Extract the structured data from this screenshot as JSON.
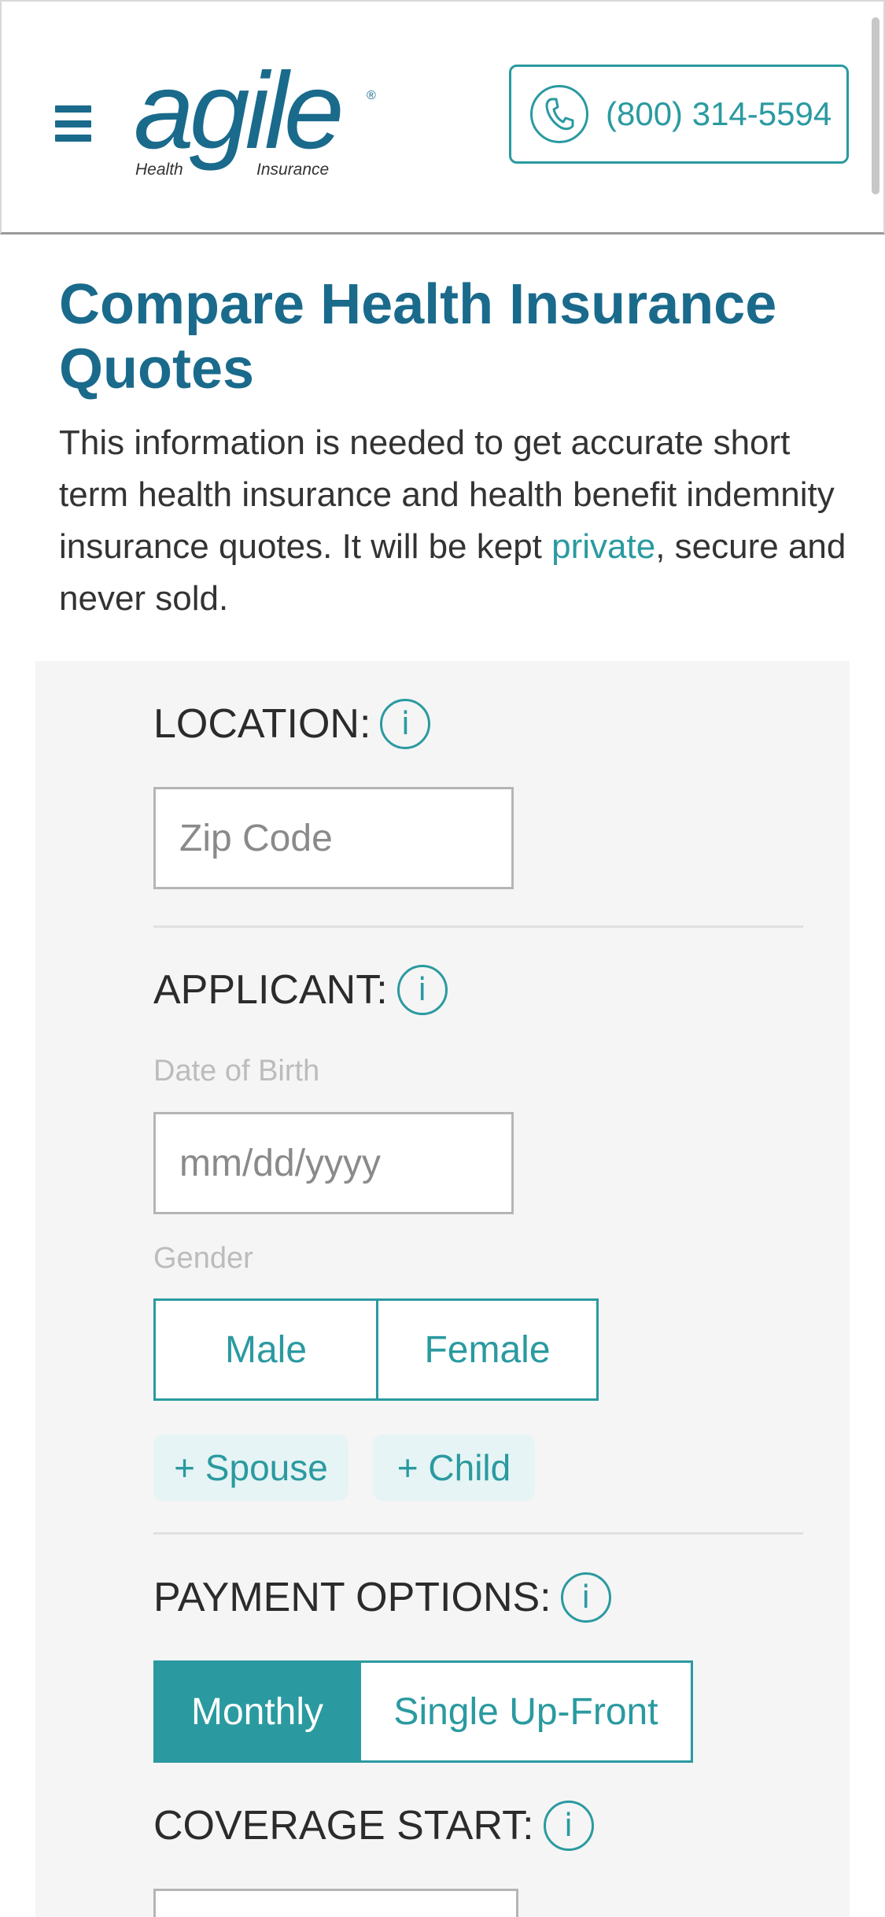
{
  "header": {
    "logo": {
      "wordmark": "agile",
      "sub_left": "Health",
      "sub_right": "Insurance",
      "registered": "®"
    },
    "phone": "(800) 314-5594"
  },
  "intro": {
    "title": "Compare Health Insurance Quotes",
    "text_before_link": "This information is needed to get accurate short term health insurance and health benefit indemnity insurance quotes. It will be kept ",
    "link": "private",
    "text_after_link": ", secure and never sold."
  },
  "form": {
    "location": {
      "title": "LOCATION:",
      "zip_placeholder": "Zip Code"
    },
    "applicant": {
      "title": "APPLICANT:",
      "dob_label": "Date of Birth",
      "dob_placeholder": "mm/dd/yyyy",
      "gender_label": "Gender",
      "gender_options": [
        "Male",
        "Female"
      ],
      "add_spouse": "+ Spouse",
      "add_child": "+ Child"
    },
    "payment": {
      "title": "PAYMENT OPTIONS:",
      "options": [
        "Monthly",
        "Single Up-Front"
      ],
      "selected": "Monthly"
    },
    "coverage": {
      "title": "COVERAGE START:"
    },
    "info_glyph": "i"
  },
  "colors": {
    "brand_blue": "#1a6a8c",
    "teal": "#2a9aa0",
    "panel_bg": "#f5f5f5"
  }
}
